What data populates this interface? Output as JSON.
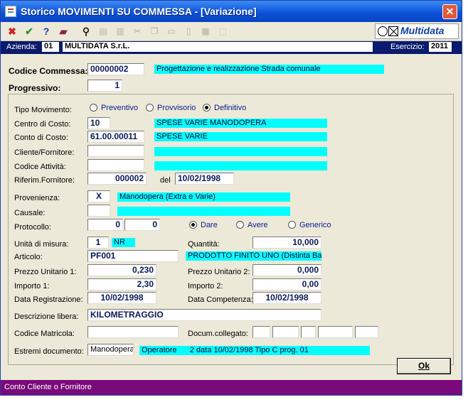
{
  "window": {
    "title": "Storico MOVIMENTI SU COMMESSA - [Variazione]",
    "close": "✕"
  },
  "brand": {
    "name": "Multidata"
  },
  "toolbar": {
    "icons": [
      "close-x-icon",
      "confirm-check-icon",
      "help-icon",
      "book-icon",
      "binoculars-icon",
      "print-icon",
      "print-preview-icon",
      "cut-icon",
      "copy-icon",
      "paste-icon",
      "new-doc-icon",
      "filter-icon",
      "select-icon"
    ]
  },
  "company": {
    "azienda_label": "Azienda:",
    "azienda_code": "01",
    "azienda_name": "MULTIDATA S.r.L.",
    "esercizio_label": "Esercizio:",
    "esercizio_value": "2011"
  },
  "header": {
    "codice_commessa_label": "Codice Commessa:",
    "codice_commessa": "00000002",
    "codice_commessa_desc": "Progettazione e realizzazione Strada comunale",
    "progressivo_label": "Progressivo:",
    "progressivo": "1"
  },
  "form": {
    "tipo_movimento_label": "Tipo Movimento:",
    "tipo_options": [
      "Preventivo",
      "Provvisorio",
      "Definitivo"
    ],
    "tipo_selected": "Definitivo",
    "centro_costo_label": "Centro di Costo:",
    "centro_costo": "10",
    "centro_costo_desc": "SPESE VARIE MANODOPERA",
    "conto_costo_label": "Conto di Costo:",
    "conto_costo": "61.00.00011",
    "conto_costo_desc": "SPESE VARIE",
    "cliente_label": "Cliente/Fornitore:",
    "cliente": "",
    "codice_attivita_label": "Codice Attività:",
    "codice_attivita": "",
    "riferim_label": "Riferim.Fornitore:",
    "riferim": "000002",
    "del_label": "del",
    "riferim_date": "10/02/1998",
    "provenienza_label": "Provenienza:",
    "provenienza": "X",
    "provenienza_desc": "Manodopera (Extra e Varie)",
    "causale_label": "Causale:",
    "causale": "",
    "protocollo_label": "Protocollo:",
    "protocollo_1": "0",
    "protocollo_2": "0",
    "segno_options": [
      "Dare",
      "Avere",
      "Generico"
    ],
    "segno_selected": "Dare",
    "um_label": "Unità di misura:",
    "um_code": "1",
    "um_desc": "NR",
    "quantita_label": "Quantità:",
    "quantita": "10,000",
    "articolo_label": "Articolo:",
    "articolo": "PF001",
    "articolo_desc": "PRODOTTO FINITO UNO (Distinta Base)",
    "prezzo1_label": "Prezzo Unitario 1:",
    "prezzo1": "0,230",
    "prezzo2_label": "Prezzo Unitario 2:",
    "prezzo2": "0,000",
    "importo1_label": "Importo 1:",
    "importo1": "2,30",
    "importo2_label": "Importo 2:",
    "importo2": "0,00",
    "data_reg_label": "Data Registrazione:",
    "data_reg": "10/02/1998",
    "data_comp_label": "Data Competenza:",
    "data_comp": "10/02/1998",
    "descrizione_label": "Descrizione libera:",
    "descrizione": "KILOMETRAGGIO",
    "matricola_label": "Codice Matricola:",
    "matricola": "",
    "docum_label": "Docum.collegato:",
    "estremi_label": "Estremi documento:",
    "estremi": "Manodopera",
    "estremi_desc": "Operatore      2 data 10/02/1998 Tipo C prog. 01"
  },
  "buttons": {
    "ok": "Ok"
  },
  "status": {
    "text": "Conto Cliente o Fornitore"
  }
}
